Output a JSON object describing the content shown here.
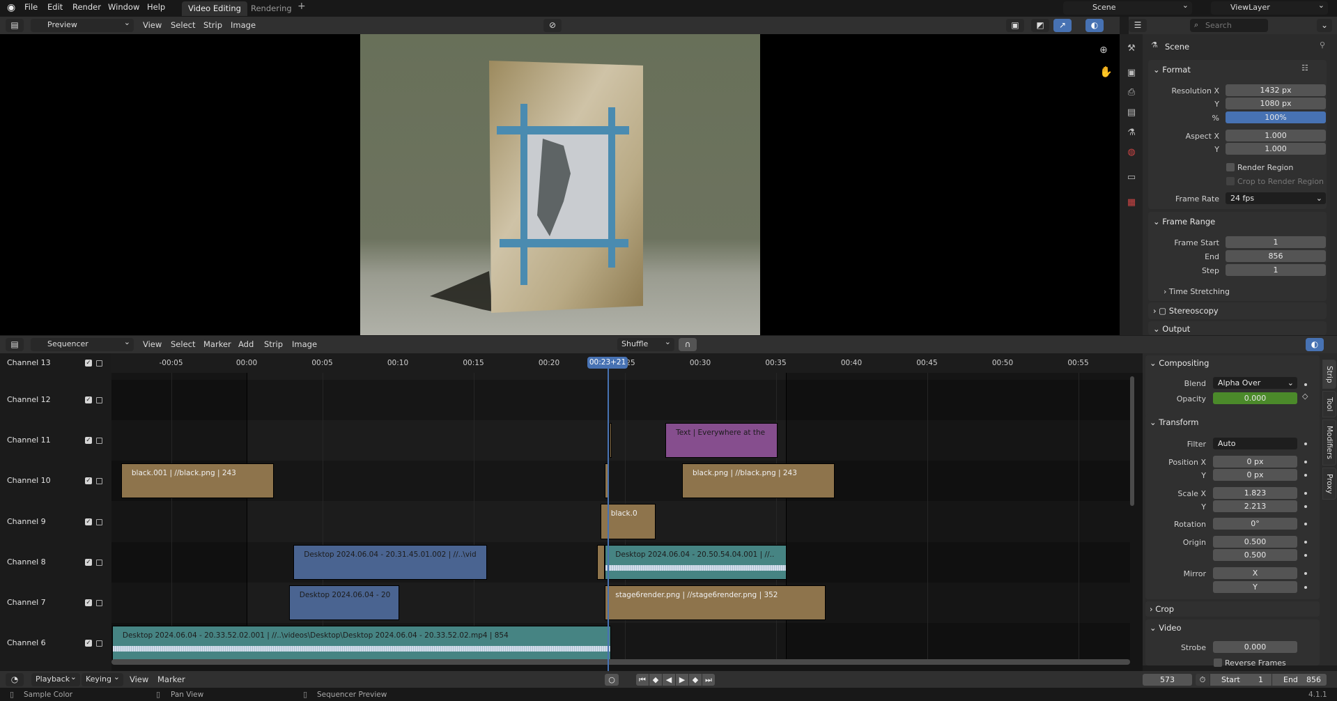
{
  "topbar": {
    "menus": [
      "File",
      "Edit",
      "Render",
      "Window",
      "Help"
    ],
    "workspace_tabs": [
      {
        "label": "Video Editing",
        "active": true
      },
      {
        "label": "Rendering",
        "active": false
      }
    ],
    "add_tab": "+",
    "scene": "Scene",
    "view_layer": "ViewLayer"
  },
  "preview_header": {
    "editor_mode": "Preview",
    "menus": [
      "View",
      "Select",
      "Strip",
      "Image"
    ]
  },
  "properties_header": {
    "search_placeholder": "Search"
  },
  "properties": {
    "context": "Scene",
    "format": {
      "title": "Format",
      "resolution_x_label": "Resolution X",
      "resolution_x": "1432 px",
      "resolution_y_label": "Y",
      "resolution_y": "1080 px",
      "percent_label": "%",
      "percent": "100%",
      "aspect_x_label": "Aspect X",
      "aspect_x": "1.000",
      "aspect_y_label": "Y",
      "aspect_y": "1.000",
      "render_region": "Render Region",
      "crop_region": "Crop to Render Region",
      "frame_rate_label": "Frame Rate",
      "frame_rate": "24 fps"
    },
    "frame_range": {
      "title": "Frame Range",
      "start_label": "Frame Start",
      "start": "1",
      "end_label": "End",
      "end": "856",
      "step_label": "Step",
      "step": "1",
      "time_stretching": "Time Stretching"
    },
    "stereoscopy": "Stereoscopy",
    "output": "Output"
  },
  "sequencer_header": {
    "editor_mode": "Sequencer",
    "menus": [
      "View",
      "Select",
      "Marker",
      "Add",
      "Strip",
      "Image"
    ],
    "overlap_mode": "Shuffle"
  },
  "timeline": {
    "playhead": "00:23+21",
    "playhead_seconds": 23.875,
    "scene_start_seconds": 0,
    "scene_end_seconds": 35.67,
    "ticks": [
      "-00:05",
      "00:00",
      "00:05",
      "00:10",
      "00:15",
      "00:20",
      "00:25",
      "00:30",
      "00:35",
      "00:40",
      "00:45",
      "00:50",
      "00:55"
    ],
    "tick_seconds": [
      -5,
      0,
      5,
      10,
      15,
      20,
      25,
      30,
      35,
      40,
      45,
      50,
      55
    ],
    "channels": [
      "Channel 13",
      "Channel 12",
      "Channel 11",
      "Channel 10",
      "Channel 9",
      "Channel 8",
      "Channel 7",
      "Channel 6"
    ],
    "strips": [
      {
        "channel": 11,
        "start": 24.0,
        "end": 24.15,
        "type": "image",
        "label": ""
      },
      {
        "channel": 11,
        "start": 27.7,
        "end": 35.1,
        "type": "text",
        "label": "Text | Everywhere at the"
      },
      {
        "channel": 10,
        "start": -8.3,
        "end": 1.8,
        "type": "image",
        "label": "black.001 | //black.png | 243"
      },
      {
        "channel": 10,
        "start": 23.7,
        "end": 23.95,
        "type": "image",
        "label": ""
      },
      {
        "channel": 10,
        "start": 28.8,
        "end": 38.9,
        "type": "image",
        "label": "black.png | //black.png | 243"
      },
      {
        "channel": 9,
        "start": 23.4,
        "end": 27.05,
        "type": "image",
        "label": "black.0"
      },
      {
        "channel": 8,
        "start": 3.1,
        "end": 15.9,
        "type": "movie",
        "label": "Desktop 2024.06.04 - 20.31.45.01.002 | //..\\vid"
      },
      {
        "channel": 8,
        "start": 23.2,
        "end": 23.7,
        "type": "image",
        "label": ""
      },
      {
        "channel": 8,
        "start": 23.7,
        "end": 35.7,
        "type": "sound",
        "label": "Desktop 2024.06.04 - 20.50.54.04.001 | //.."
      },
      {
        "channel": 7,
        "start": 2.8,
        "end": 10.1,
        "type": "movie",
        "label": "Desktop 2024.06.04 - 20"
      },
      {
        "channel": 7,
        "start": 23.7,
        "end": 38.3,
        "type": "image",
        "label": "stage6render.png | //stage6render.png | 352"
      },
      {
        "channel": 6,
        "start": -8.9,
        "end": 24.1,
        "type": "sound",
        "label": "Desktop 2024.06.04 - 20.33.52.02.001 | //..\\videos\\Desktop\\Desktop 2024.06.04 - 20.33.52.02.mp4 | 854"
      }
    ]
  },
  "strip_colors": {
    "image": "#8e744c",
    "text": "#864e8e",
    "movie": "#4a6491",
    "sound": "#468483"
  },
  "strip_panel": {
    "compositing": {
      "title": "Compositing",
      "blend_label": "Blend",
      "blend": "Alpha Over",
      "opacity_label": "Opacity",
      "opacity": "0.000"
    },
    "transform": {
      "title": "Transform",
      "filter_label": "Filter",
      "filter": "Auto",
      "pos_x_label": "Position X",
      "pos_x": "0 px",
      "pos_y_label": "Y",
      "pos_y": "0 px",
      "scale_x_label": "Scale X",
      "scale_x": "1.823",
      "scale_y_label": "Y",
      "scale_y": "2.213",
      "rotation_label": "Rotation",
      "rotation": "0°",
      "origin_label": "Origin",
      "origin_x": "0.500",
      "origin_y": "0.500",
      "mirror_label": "Mirror",
      "mirror_x": "X",
      "mirror_y": "Y"
    },
    "crop": "Crop",
    "video": {
      "title": "Video",
      "strobe_label": "Strobe",
      "strobe": "0.000",
      "reverse": "Reverse Frames"
    },
    "tabs": [
      "Strip",
      "Tool",
      "Modifiers",
      "Proxy"
    ]
  },
  "timeline_header": {
    "menus": [
      "Playback",
      "Keying",
      "View",
      "Marker"
    ],
    "current_frame": "573",
    "start_label": "Start",
    "start": "1",
    "end_label": "End",
    "end": "856"
  },
  "statusbar": {
    "hints": [
      "Sample Color",
      "Pan View",
      "Sequencer Preview"
    ],
    "version": "4.1.1"
  }
}
